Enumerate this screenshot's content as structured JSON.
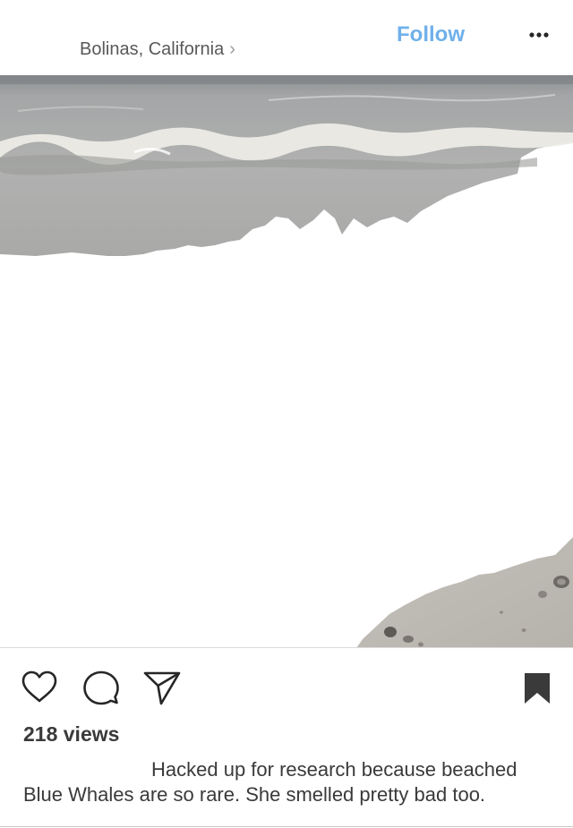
{
  "header": {
    "location": "Bolinas, California",
    "location_chevron": "›",
    "follow_label": "Follow",
    "more_icon": "more-horizontal-icon"
  },
  "media": {
    "description_icon": "beach-photo",
    "colors": {
      "sea": "#a9abaa",
      "foam": "#e8e6e0",
      "sand": "#bdb9b3"
    }
  },
  "actions": {
    "like_icon": "heart-icon",
    "comment_icon": "comment-bubble-icon",
    "share_icon": "paper-plane-icon",
    "save_icon": "bookmark-icon"
  },
  "post": {
    "views": "218 views",
    "caption": "Hacked up for research because beached Blue Whales are so rare. She smelled pretty bad too."
  },
  "colors": {
    "follow": "#6fb0ea",
    "text": "#3a3a3a",
    "muted": "#595959"
  }
}
